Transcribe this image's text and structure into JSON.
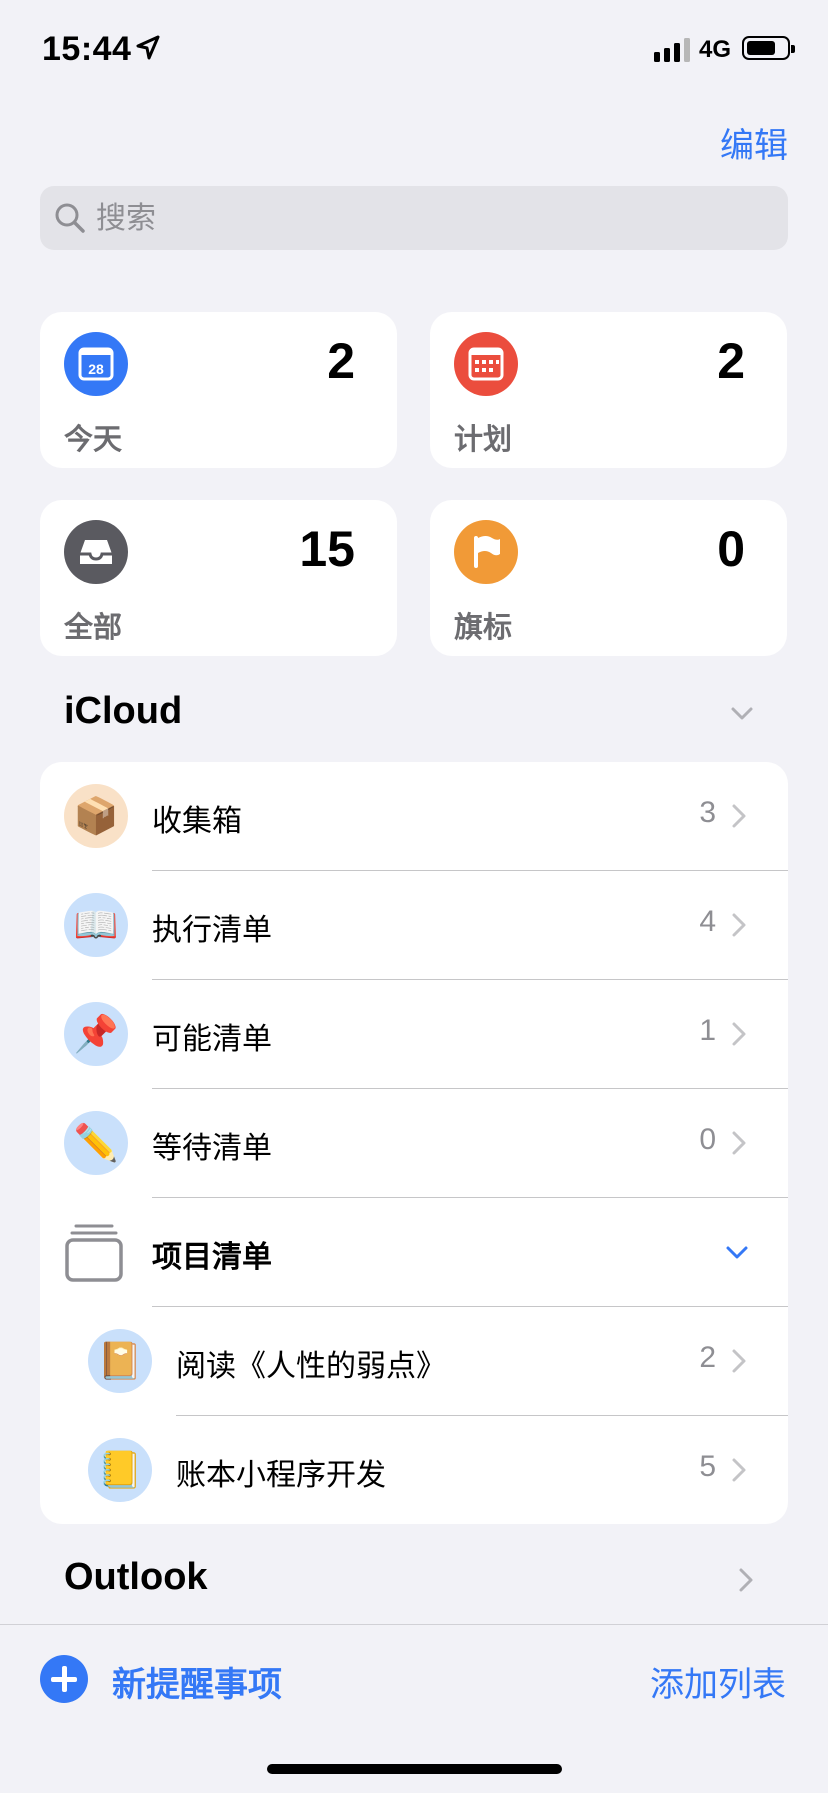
{
  "status_bar": {
    "time": "15:44",
    "network": "4G"
  },
  "header": {
    "edit_label": "编辑"
  },
  "search": {
    "placeholder": "搜索"
  },
  "smart_lists": [
    {
      "label": "今天",
      "count": "2",
      "color": "#3478f6",
      "icon": "calendar-today-icon",
      "date": "28"
    },
    {
      "label": "计划",
      "count": "2",
      "color": "#eb4d3d",
      "icon": "calendar-grid-icon"
    },
    {
      "label": "全部",
      "count": "15",
      "color": "#5a5a60",
      "icon": "tray-icon"
    },
    {
      "label": "旗标",
      "count": "0",
      "color": "#f19a37",
      "icon": "flag-icon"
    }
  ],
  "icloud": {
    "title": "iCloud",
    "lists": [
      {
        "label": "收集箱",
        "count": "3",
        "emoji": "📦",
        "bg": "#f9e1c7"
      },
      {
        "label": "执行清单",
        "count": "4",
        "emoji": "📖",
        "bg": "#c9e0fb"
      },
      {
        "label": "可能清单",
        "count": "1",
        "emoji": "📌",
        "bg": "#c9e0fb"
      },
      {
        "label": "等待清单",
        "count": "0",
        "emoji": "✏️",
        "bg": "#c9e0fb"
      }
    ],
    "group": {
      "label": "项目清单",
      "icon": "stacked-lists-icon",
      "children": [
        {
          "label": "阅读《人性的弱点》",
          "count": "2",
          "emoji": "📔",
          "bg": "#c9e0fb"
        },
        {
          "label": "账本小程序开发",
          "count": "5",
          "emoji": "📒",
          "bg": "#c9e0fb"
        }
      ]
    }
  },
  "outlook": {
    "title": "Outlook"
  },
  "toolbar": {
    "new_reminder_label": "新提醒事项",
    "add_list_label": "添加列表"
  },
  "colors": {
    "accent": "#3478f6",
    "background": "#f2f2f7"
  }
}
